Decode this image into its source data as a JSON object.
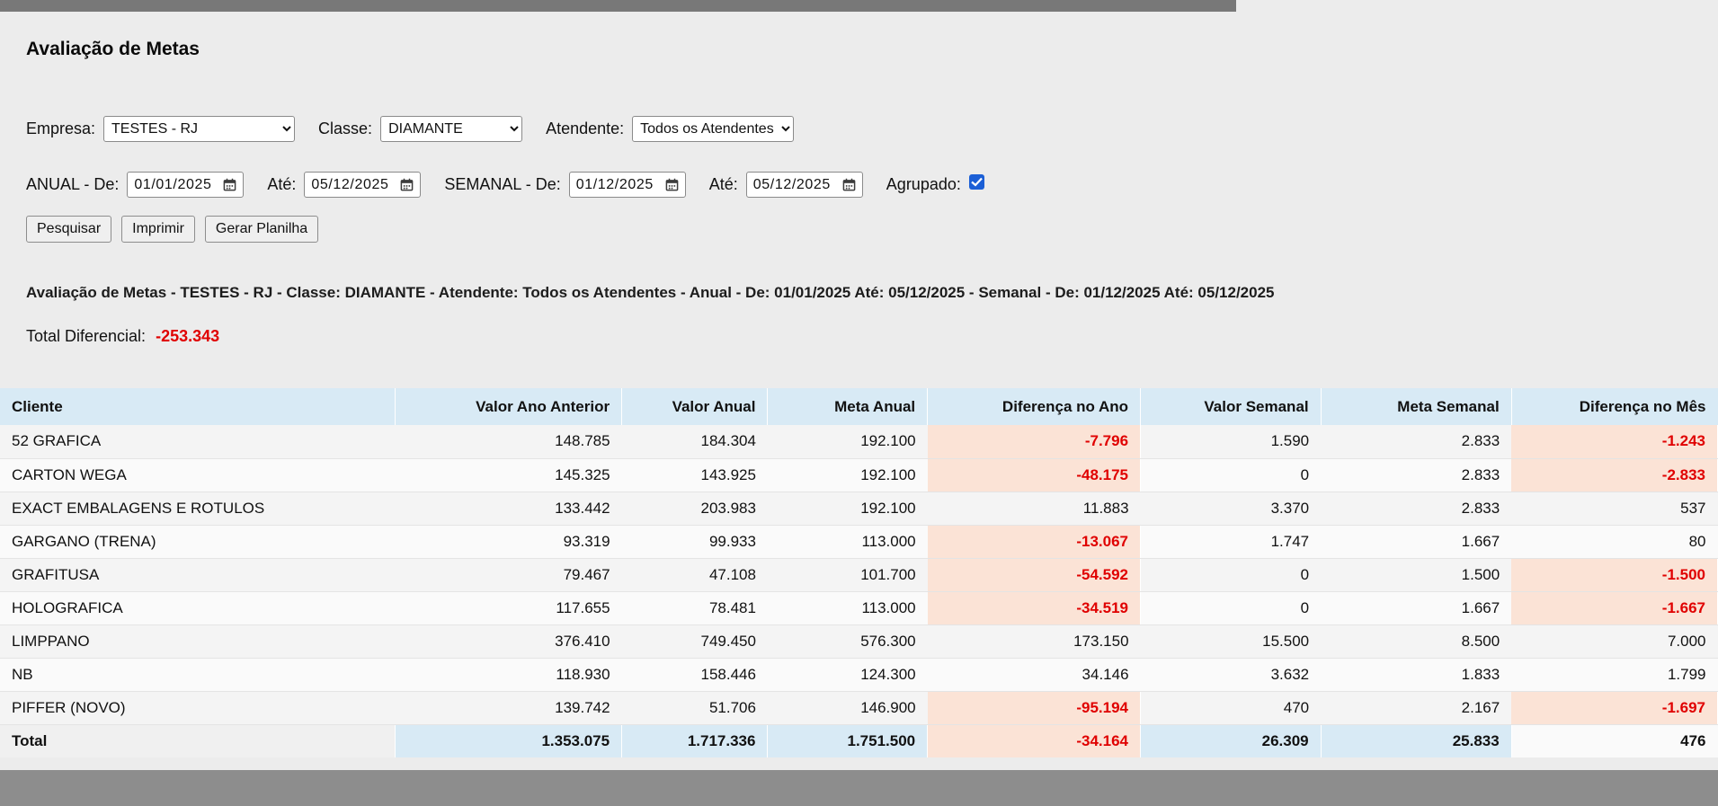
{
  "page": {
    "title": "Avaliação de Metas"
  },
  "filters": {
    "empresa": {
      "label": "Empresa:",
      "value": "TESTES - RJ"
    },
    "classe": {
      "label": "Classe:",
      "value": "DIAMANTE"
    },
    "atendente": {
      "label": "Atendente:",
      "value": "Todos os Atendentes"
    },
    "anual": {
      "label": "ANUAL - De:",
      "de": "01/01/2025",
      "ate_label": "Até:",
      "ate": "05/12/2025"
    },
    "semanal": {
      "label": "SEMANAL - De:",
      "de": "01/12/2025",
      "ate_label": "Até:",
      "ate": "05/12/2025"
    },
    "agrupado": {
      "label": "Agrupado:",
      "checked": true
    }
  },
  "actions": {
    "pesquisar": "Pesquisar",
    "imprimir": "Imprimir",
    "gerar_planilha": "Gerar Planilha"
  },
  "summary": {
    "line": "Avaliação de Metas - TESTES - RJ - Classe: DIAMANTE - Atendente: Todos os Atendentes - Anual - De: 01/01/2025 Até: 05/12/2025 - Semanal - De: 01/12/2025 Até: 05/12/2025",
    "total_label": "Total Diferencial:",
    "total_value": "-253.343"
  },
  "table": {
    "columns": [
      {
        "label": "Cliente",
        "align": "left"
      },
      {
        "label": "Valor Ano Anterior",
        "align": "right"
      },
      {
        "label": "Valor Anual",
        "align": "right"
      },
      {
        "label": "Meta Anual",
        "align": "right"
      },
      {
        "label": "Diferença no Ano",
        "align": "right",
        "diff": true
      },
      {
        "label": "Valor Semanal",
        "align": "right"
      },
      {
        "label": "Meta Semanal",
        "align": "right"
      },
      {
        "label": "Diferença no Mês",
        "align": "right",
        "diff": true
      }
    ],
    "rows": [
      [
        "52 GRAFICA",
        "148.785",
        "184.304",
        "192.100",
        "-7.796",
        "1.590",
        "2.833",
        "-1.243"
      ],
      [
        "CARTON WEGA",
        "145.325",
        "143.925",
        "192.100",
        "-48.175",
        "0",
        "2.833",
        "-2.833"
      ],
      [
        "EXACT EMBALAGENS E ROTULOS",
        "133.442",
        "203.983",
        "192.100",
        "11.883",
        "3.370",
        "2.833",
        "537"
      ],
      [
        "GARGANO (TRENA)",
        "93.319",
        "99.933",
        "113.000",
        "-13.067",
        "1.747",
        "1.667",
        "80"
      ],
      [
        "GRAFITUSA",
        "79.467",
        "47.108",
        "101.700",
        "-54.592",
        "0",
        "1.500",
        "-1.500"
      ],
      [
        "HOLOGRAFICA",
        "117.655",
        "78.481",
        "113.000",
        "-34.519",
        "0",
        "1.667",
        "-1.667"
      ],
      [
        "LIMPPANO",
        "376.410",
        "749.450",
        "576.300",
        "173.150",
        "15.500",
        "8.500",
        "7.000"
      ],
      [
        "NB",
        "118.930",
        "158.446",
        "124.300",
        "34.146",
        "3.632",
        "1.833",
        "1.799"
      ],
      [
        "PIFFER (NOVO)",
        "139.742",
        "51.706",
        "146.900",
        "-95.194",
        "470",
        "2.167",
        "-1.697"
      ]
    ],
    "total_row": [
      "Total",
      "1.353.075",
      "1.717.336",
      "1.751.500",
      "-34.164",
      "26.309",
      "25.833",
      "476"
    ]
  },
  "colors": {
    "header_bg": "#d8eaf5",
    "negative_bg": "#fbe3d6",
    "negative_text": "#e00000",
    "checkbox_blue": "#1b5fd6"
  }
}
